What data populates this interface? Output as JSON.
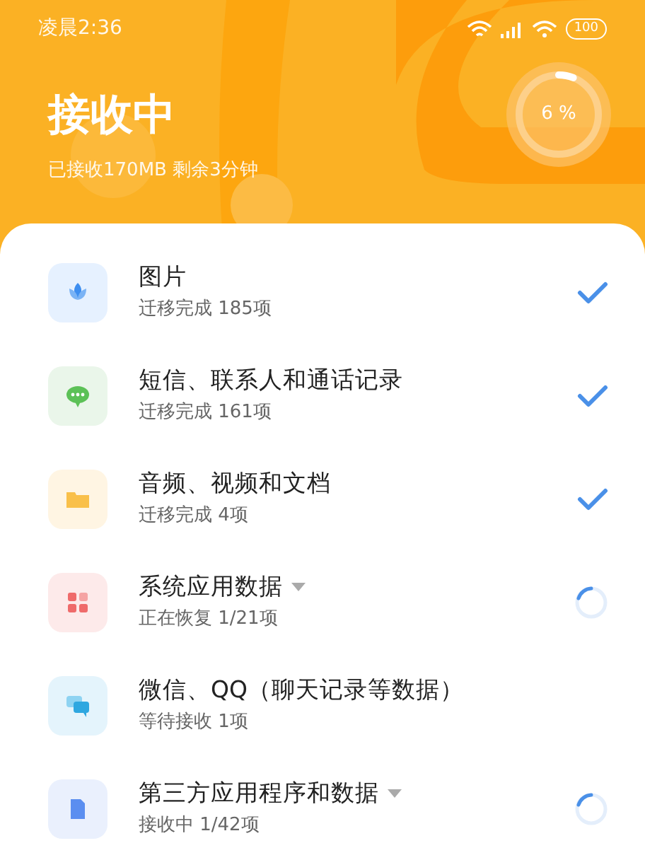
{
  "status_bar": {
    "time": "凌晨2:36",
    "battery": "100"
  },
  "header": {
    "title": "接收中",
    "subtitle": "已接收170MB 剩余3分钟",
    "progress": {
      "label": "6 %",
      "level": 0.06
    }
  },
  "items": [
    {
      "kind": "photo",
      "title": "图片",
      "subtitle": "迁移完成 185项",
      "done": true,
      "loading": false,
      "expandable": false
    },
    {
      "kind": "message",
      "title": "短信、联系人和通话记录",
      "subtitle": "迁移完成 161项",
      "done": true,
      "loading": false,
      "expandable": false
    },
    {
      "kind": "folder",
      "title": "音频、视频和文档",
      "subtitle": "迁移完成 4项",
      "done": true,
      "loading": false,
      "expandable": false
    },
    {
      "kind": "apps",
      "title": "系统应用数据",
      "subtitle": "正在恢复 1/21项",
      "done": false,
      "loading": true,
      "expandable": true
    },
    {
      "kind": "chat",
      "title": "微信、QQ（聊天记录等数据）",
      "subtitle": "等待接收 1项",
      "done": false,
      "loading": false,
      "expandable": false
    },
    {
      "kind": "file",
      "title": "第三方应用程序和数据",
      "subtitle": "接收中 1/42项",
      "done": false,
      "loading": true,
      "expandable": true
    }
  ]
}
